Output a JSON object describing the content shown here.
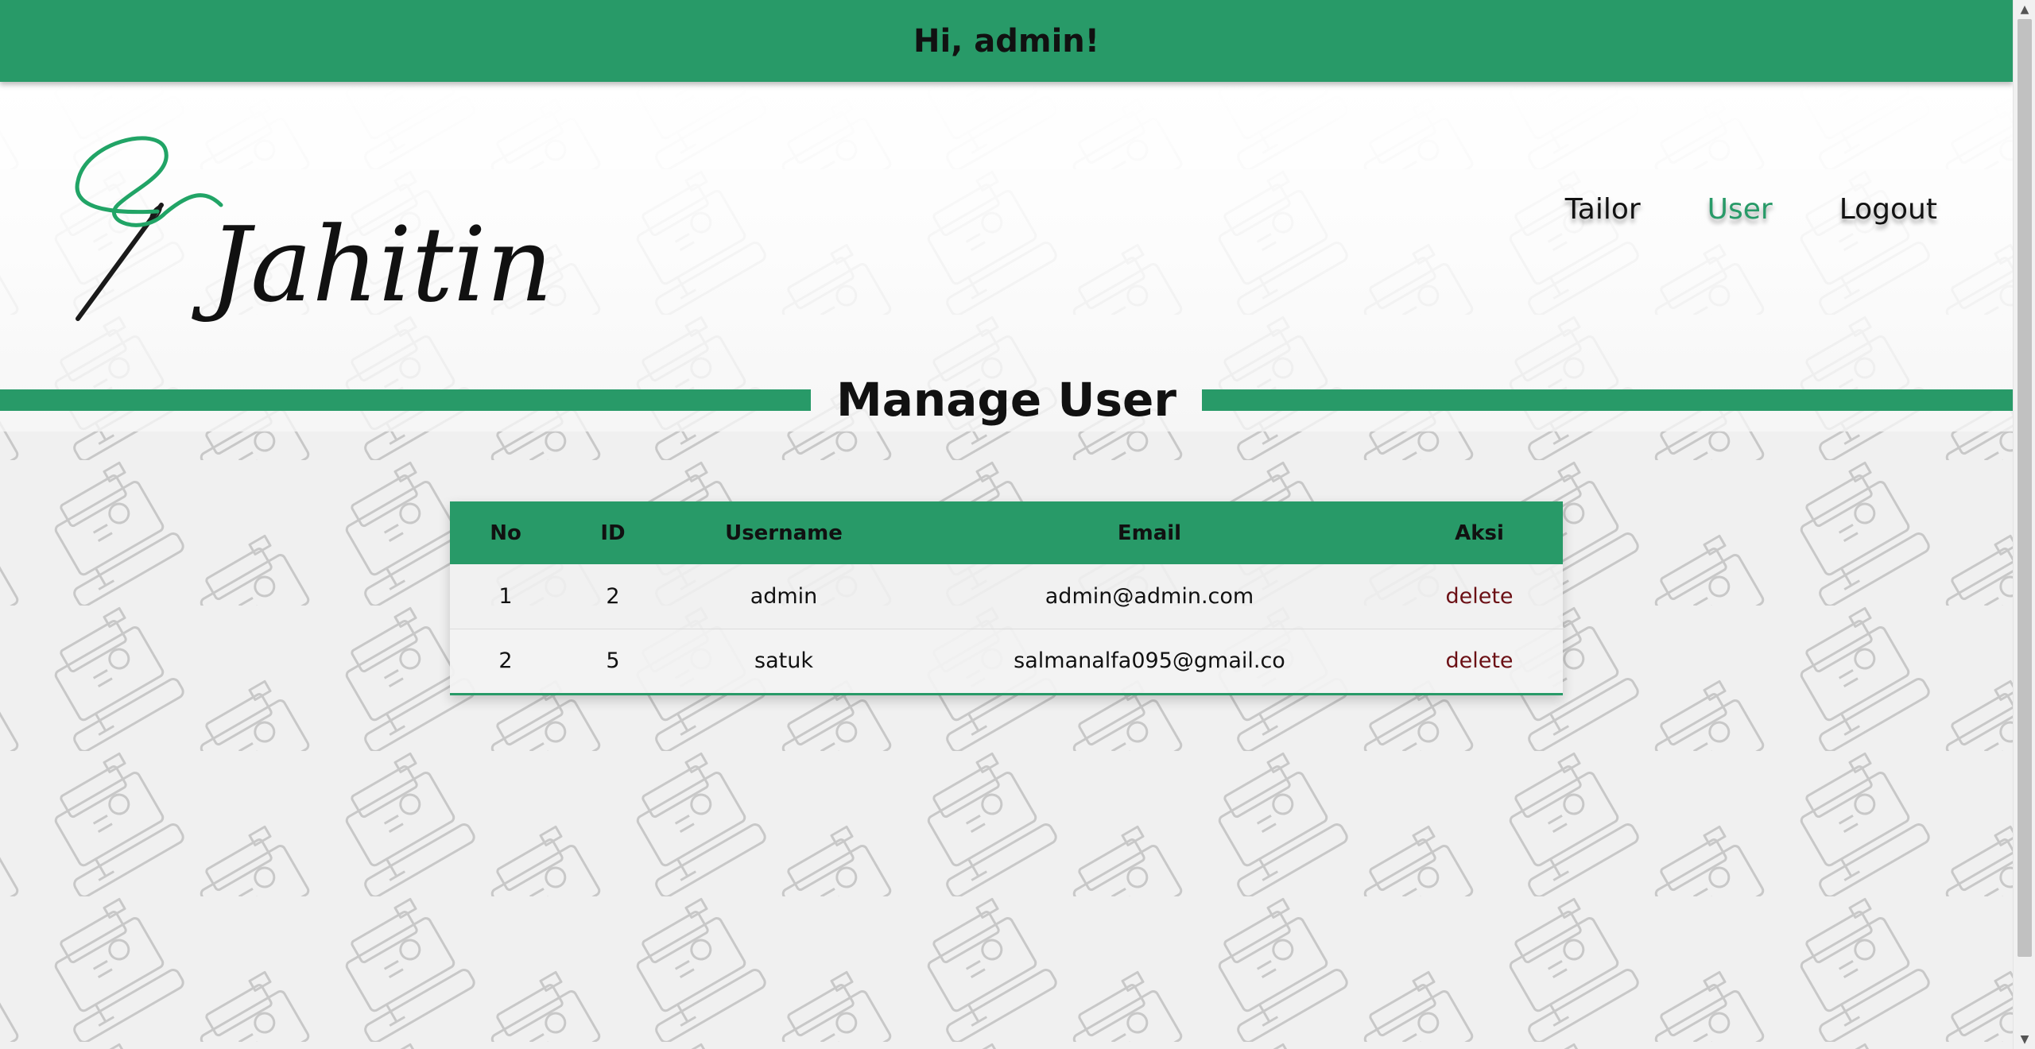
{
  "banner": {
    "greeting": "Hi, admin!"
  },
  "logo": {
    "text": "Jahitin",
    "icon": "needle-thread-icon",
    "accent_color": "#21a466"
  },
  "nav": {
    "items": [
      {
        "label": "Tailor",
        "active": false
      },
      {
        "label": "User",
        "active": true
      },
      {
        "label": "Logout",
        "active": false
      }
    ]
  },
  "section": {
    "title": "Manage User"
  },
  "table": {
    "headers": {
      "no": "No",
      "id": "ID",
      "username": "Username",
      "email": "Email",
      "aksi": "Aksi"
    },
    "rows": [
      {
        "no": "1",
        "id": "2",
        "username": "admin",
        "email": "admin@admin.com",
        "aksi": "delete"
      },
      {
        "no": "2",
        "id": "5",
        "username": "satuk",
        "email": "salmanalfa095@gmail.co",
        "aksi": "delete"
      }
    ]
  },
  "colors": {
    "primary": "#289a68",
    "delete": "#6b0f14",
    "background": "#f0f0f0"
  },
  "background_icon": "sewing-machine-icon"
}
